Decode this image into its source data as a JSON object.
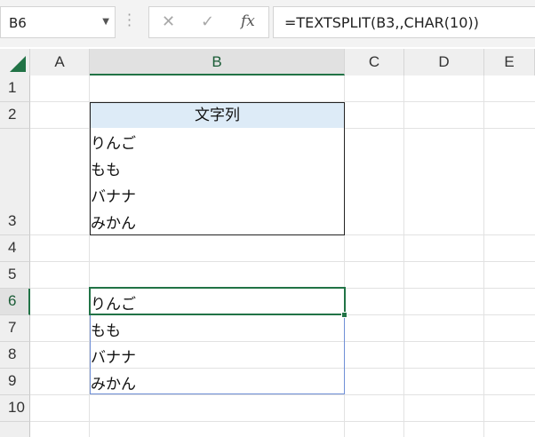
{
  "name_box": {
    "value": "B6"
  },
  "formula_bar": {
    "cancel_glyph": "✕",
    "enter_glyph": "✓",
    "fx_glyph": "fx",
    "formula": "=TEXTSPLIT(B3,,CHAR(10))"
  },
  "columns": [
    "A",
    "B",
    "C",
    "D",
    "E"
  ],
  "rows": [
    "1",
    "2",
    "3",
    "4",
    "5",
    "6",
    "7",
    "8",
    "9",
    "10"
  ],
  "table": {
    "header": "文字列",
    "b3_lines": [
      "りんご",
      "もも",
      "バナナ",
      "みかん"
    ]
  },
  "spill": [
    "りんご",
    "もも",
    "バナナ",
    "みかん"
  ],
  "colors": {
    "accent": "#217346",
    "header_fill": "#ddebf7",
    "spill_border": "#6f8fd6"
  }
}
